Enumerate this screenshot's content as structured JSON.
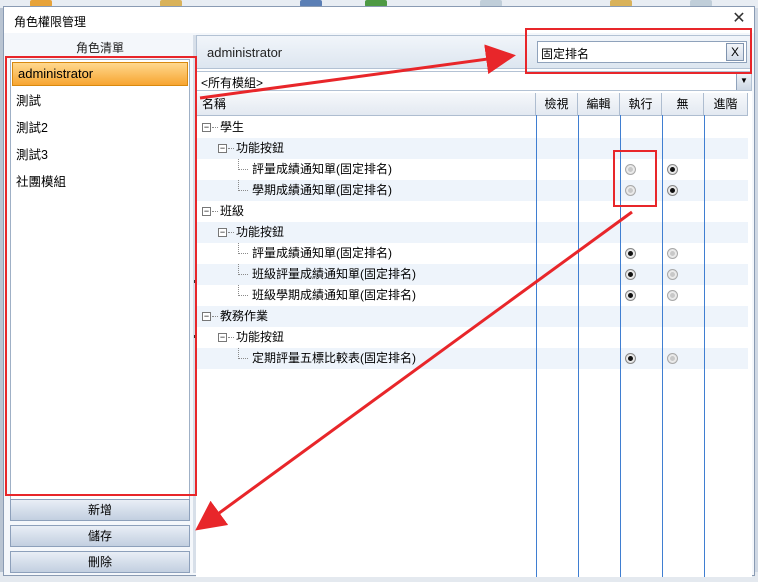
{
  "window": {
    "title": "角色權限管理"
  },
  "left_panel": {
    "header": "角色清單",
    "roles": [
      {
        "label": "administrator",
        "selected": true
      },
      {
        "label": "測試",
        "selected": false
      },
      {
        "label": "測試2",
        "selected": false
      },
      {
        "label": "測試3",
        "selected": false
      },
      {
        "label": "社團模組",
        "selected": false
      }
    ],
    "buttons": {
      "add": "新增",
      "save": "儲存",
      "delete": "刪除"
    }
  },
  "right_panel": {
    "role_title": "administrator",
    "search_value": "固定排名",
    "search_clear": "X",
    "module_filter": "<所有模組>",
    "columns": [
      "名稱",
      "檢視",
      "編輯",
      "執行",
      "無",
      "進階"
    ],
    "rows": [
      {
        "label": "學生",
        "level": 0,
        "expander": "−",
        "exec": null,
        "none": null
      },
      {
        "label": "功能按鈕",
        "level": 1,
        "expander": "−",
        "exec": null,
        "none": null
      },
      {
        "label": "評量成績通知單(固定排名)",
        "level": 2,
        "expander": "",
        "exec": false,
        "none": true
      },
      {
        "label": "學期成績通知單(固定排名)",
        "level": 2,
        "expander": "",
        "exec": false,
        "none": true
      },
      {
        "label": "班級",
        "level": 0,
        "expander": "−",
        "exec": null,
        "none": null
      },
      {
        "label": "功能按鈕",
        "level": 1,
        "expander": "−",
        "exec": null,
        "none": null
      },
      {
        "label": "評量成績通知單(固定排名)",
        "level": 2,
        "expander": "",
        "exec": true,
        "none": false
      },
      {
        "label": "班級評量成績通知單(固定排名)",
        "level": 2,
        "expander": "",
        "exec": true,
        "none": false
      },
      {
        "label": "班級學期成績通知單(固定排名)",
        "level": 2,
        "expander": "",
        "exec": true,
        "none": false
      },
      {
        "label": "教務作業",
        "level": 0,
        "expander": "−",
        "exec": null,
        "none": null
      },
      {
        "label": "功能按鈕",
        "level": 1,
        "expander": "−",
        "exec": null,
        "none": null
      },
      {
        "label": "定期評量五標比較表(固定排名)",
        "level": 2,
        "expander": "",
        "exec": true,
        "none": false
      }
    ]
  },
  "colors": {
    "annotation": "#e8262a",
    "grid_line": "#3f7ed1",
    "selected_role": "#f7a531"
  }
}
